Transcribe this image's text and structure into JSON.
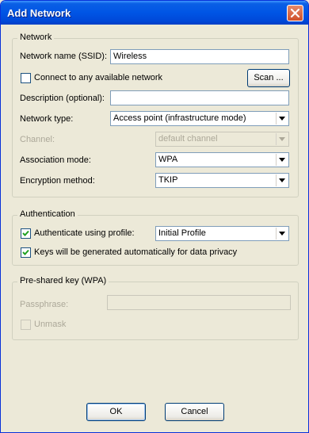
{
  "window": {
    "title": "Add Network"
  },
  "network": {
    "group_title": "Network",
    "ssid_label": "Network name (SSID):",
    "ssid_value": "Wireless",
    "connect_any_label": "Connect to any available network",
    "connect_any_checked": false,
    "scan_button": "Scan ...",
    "description_label": "Description (optional):",
    "description_value": "",
    "network_type_label": "Network type:",
    "network_type_value": "Access point (infrastructure mode)",
    "channel_label": "Channel:",
    "channel_value": "default channel",
    "association_label": "Association mode:",
    "association_value": "WPA",
    "encryption_label": "Encryption method:",
    "encryption_value": "TKIP"
  },
  "authentication": {
    "group_title": "Authentication",
    "auth_profile_label": "Authenticate using profile:",
    "auth_profile_checked": true,
    "profile_value": "Initial Profile",
    "keys_auto_label": "Keys will be generated automatically for data privacy",
    "keys_auto_checked": true
  },
  "psk": {
    "group_title": "Pre-shared key (WPA)",
    "passphrase_label": "Passphrase:",
    "passphrase_value": "",
    "unmask_label": "Unmask",
    "unmask_checked": false
  },
  "footer": {
    "ok_label": "OK",
    "cancel_label": "Cancel"
  },
  "colors": {
    "titlebar": "#0055e5",
    "face": "#ece9d8",
    "field_border": "#7f9db9",
    "disabled_text": "#aca899"
  },
  "icons": {
    "close": "close-icon",
    "dropdown": "chevron-down-icon",
    "check": "checkmark-icon"
  }
}
